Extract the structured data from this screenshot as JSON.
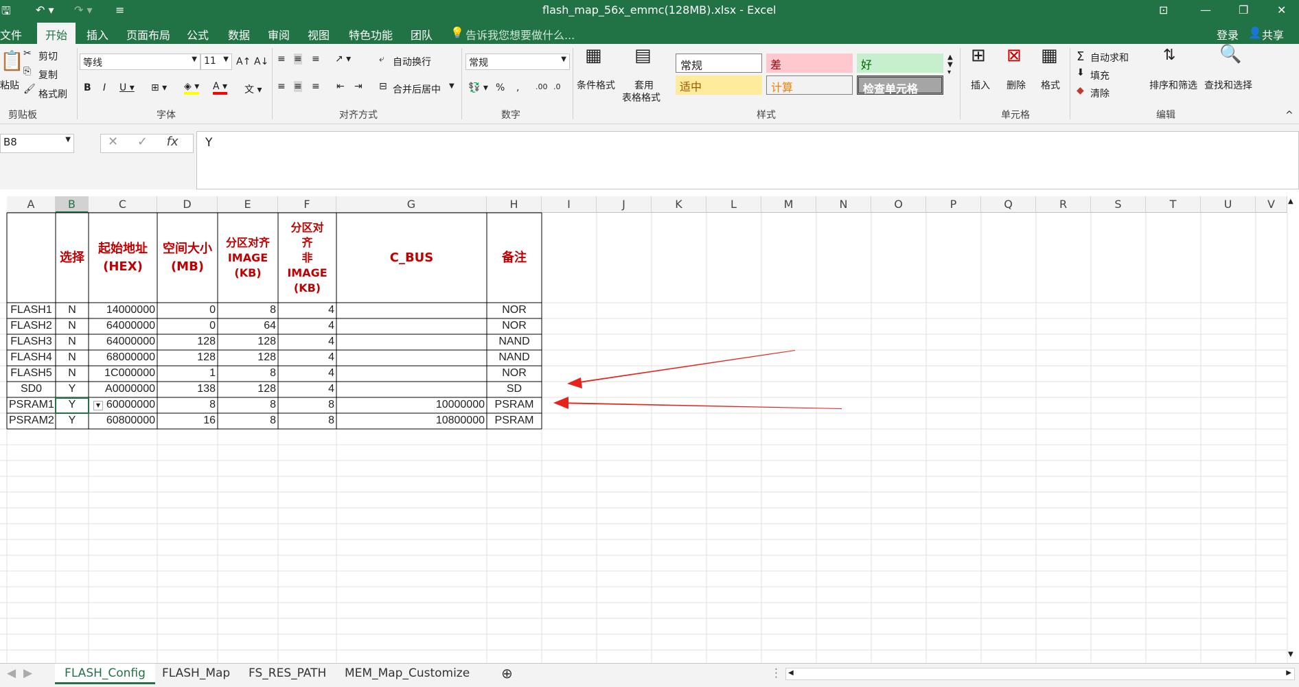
{
  "window": {
    "title": "flash_map_56x_emmc(128MB).xlsx - Excel"
  },
  "ribbon_tabs": [
    "文件",
    "开始",
    "插入",
    "页面布局",
    "公式",
    "数据",
    "审阅",
    "视图",
    "特色功能",
    "团队"
  ],
  "tell_me": "告诉我您想要做什么...",
  "account": {
    "login": "登录",
    "share": "共享"
  },
  "clipboard": {
    "cut": "剪切",
    "copy": "复制",
    "format_painter": "格式刷",
    "paste": "粘贴",
    "group": "剪贴板"
  },
  "font": {
    "name": "等线",
    "size": "11",
    "group": "字体"
  },
  "alignment": {
    "wrap": "自动换行",
    "merge": "合并后居中",
    "group": "对齐方式"
  },
  "number": {
    "format": "常规",
    "group": "数字"
  },
  "styles": {
    "cond": "条件格式",
    "table_l1": "套用",
    "table_l2": "表格格式",
    "normal": "常规",
    "bad": "差",
    "good": "好",
    "neutral": "适中",
    "calc": "计算",
    "check": "检查单元格",
    "group": "样式"
  },
  "cells": {
    "insert": "插入",
    "delete": "删除",
    "format": "格式",
    "group": "单元格"
  },
  "editing": {
    "autosum": "自动求和",
    "fill": "填充",
    "clear": "清除",
    "sort": "排序和筛选",
    "find": "查找和选择",
    "group": "编辑"
  },
  "formula_bar": {
    "name_box": "B8",
    "value": "Y"
  },
  "columns": [
    "A",
    "B",
    "C",
    "D",
    "E",
    "F",
    "G",
    "H",
    "I",
    "J",
    "K",
    "L",
    "M",
    "N",
    "O",
    "P",
    "Q",
    "R",
    "S",
    "T",
    "U",
    "V"
  ],
  "table": {
    "headers": [
      "",
      "选择",
      "起始地址\n(HEX)",
      "空间大小\n(MB)",
      "分区对齐\nIMAGE\n(KB)",
      "分区对\n齐\n非\nIMAGE\n(KB)",
      "C_BUS",
      "备注"
    ],
    "rows": [
      [
        "FLASH1",
        "N",
        "14000000",
        "0",
        "8",
        "4",
        "",
        "NOR"
      ],
      [
        "FLASH2",
        "N",
        "64000000",
        "0",
        "64",
        "4",
        "",
        "NOR"
      ],
      [
        "FLASH3",
        "N",
        "64000000",
        "128",
        "128",
        "4",
        "",
        "NAND"
      ],
      [
        "FLASH4",
        "N",
        "68000000",
        "128",
        "128",
        "4",
        "",
        "NAND"
      ],
      [
        "FLASH5",
        "N",
        "1C000000",
        "1",
        "8",
        "4",
        "",
        "NOR"
      ],
      [
        "SD0",
        "Y",
        "A0000000",
        "138",
        "128",
        "4",
        "",
        "SD"
      ],
      [
        "PSRAM1",
        "Y",
        "60000000",
        "8",
        "8",
        "8",
        "10000000",
        "PSRAM"
      ],
      [
        "PSRAM2",
        "Y",
        "60800000",
        "16",
        "8",
        "8",
        "10800000",
        "PSRAM"
      ]
    ]
  },
  "sheets": [
    "FLASH_Config",
    "FLASH_Map",
    "FS_RES_PATH",
    "MEM_Map_Customize"
  ],
  "colors": {
    "excel_green": "#217346",
    "header_red": "#c00000",
    "arrow": "#e8221a"
  }
}
